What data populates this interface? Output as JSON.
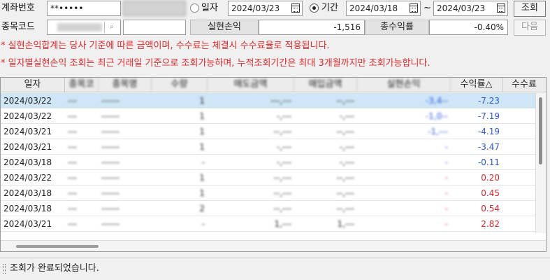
{
  "form": {
    "account_label": "계좌번호",
    "account_value": "**•••••",
    "period_radio_label": "기간",
    "date_radio_label": "일자",
    "date_value": "2024/03/23",
    "period_from": "2024/03/18",
    "period_sep": "~",
    "period_to": "2024/03/23",
    "query_button": "조회",
    "stock_code_label": "종목코드",
    "realized_pl_label": "실현손익",
    "realized_pl_value": "-1,516",
    "total_return_label": "총수익률",
    "total_return_value": "-0.40%",
    "next_button": "다음"
  },
  "notices": [
    "* 실현손익합계는 당사 기준에 따른 금액이며, 수수료는 체결시 수수료율로 적용됩니다.",
    "* 일자별실현손익 조회는 최근 거래일 기준으로 조회가능하며, 누적조회기간은 최대 3개월까지만 조회가능합니다."
  ],
  "table": {
    "columns": [
      "일자",
      "종목코드",
      "종목명",
      "수량",
      "매도금액",
      "매입금액",
      "실현손익",
      "수익률△",
      "수수료"
    ],
    "rows": [
      {
        "date": "2024/03/22",
        "code": "---",
        "name": "------",
        "qty": "1",
        "sell": "---,---",
        "buy": "--,---",
        "pl": "-3,4--",
        "rate": "-7.23",
        "sign": "neg"
      },
      {
        "date": "2024/03/22",
        "code": "---",
        "name": "------",
        "qty": "1",
        "sell": "-,---",
        "buy": "-,---",
        "pl": "-1,0--",
        "rate": "-7.19",
        "sign": "neg"
      },
      {
        "date": "2024/03/21",
        "code": "---",
        "name": "------",
        "qty": "1",
        "sell": "--,---",
        "buy": "--,---",
        "pl": "-1,---",
        "rate": "-4.19",
        "sign": "neg"
      },
      {
        "date": "2024/03/21",
        "code": "---",
        "name": "------",
        "qty": "1",
        "sell": "-,---",
        "buy": "-,---",
        "pl": "-",
        "rate": "-3.47",
        "sign": "neg"
      },
      {
        "date": "2024/03/18",
        "code": "---",
        "name": "------",
        "qty": "-",
        "sell": "-,---",
        "buy": "-,---",
        "pl": "-",
        "rate": "-0.11",
        "sign": "neg"
      },
      {
        "date": "2024/03/22",
        "code": "---",
        "name": "------",
        "qty": "1",
        "sell": "--,---",
        "buy": "--,---",
        "pl": "-",
        "rate": "0.20",
        "sign": "pos"
      },
      {
        "date": "2024/03/18",
        "code": "---",
        "name": "------",
        "qty": "1",
        "sell": "--,---",
        "buy": "--,---",
        "pl": "-",
        "rate": "0.45",
        "sign": "pos"
      },
      {
        "date": "2024/03/18",
        "code": "---",
        "name": "------",
        "qty": "2",
        "sell": "--,---",
        "buy": "--,---",
        "pl": "-",
        "rate": "0.54",
        "sign": "pos"
      },
      {
        "date": "2024/03/21",
        "code": "---",
        "name": "------",
        "qty": "-",
        "sell": "1,---",
        "buy": "1,---",
        "pl": "-",
        "rate": "2.82",
        "sign": "pos"
      }
    ]
  },
  "status": {
    "message": "조회가 완료되었습니다."
  },
  "colors": {
    "negative": "#2b56d8",
    "positive": "#d8262c",
    "notice": "#e0282a",
    "selected_row": "#cfe6f7"
  }
}
